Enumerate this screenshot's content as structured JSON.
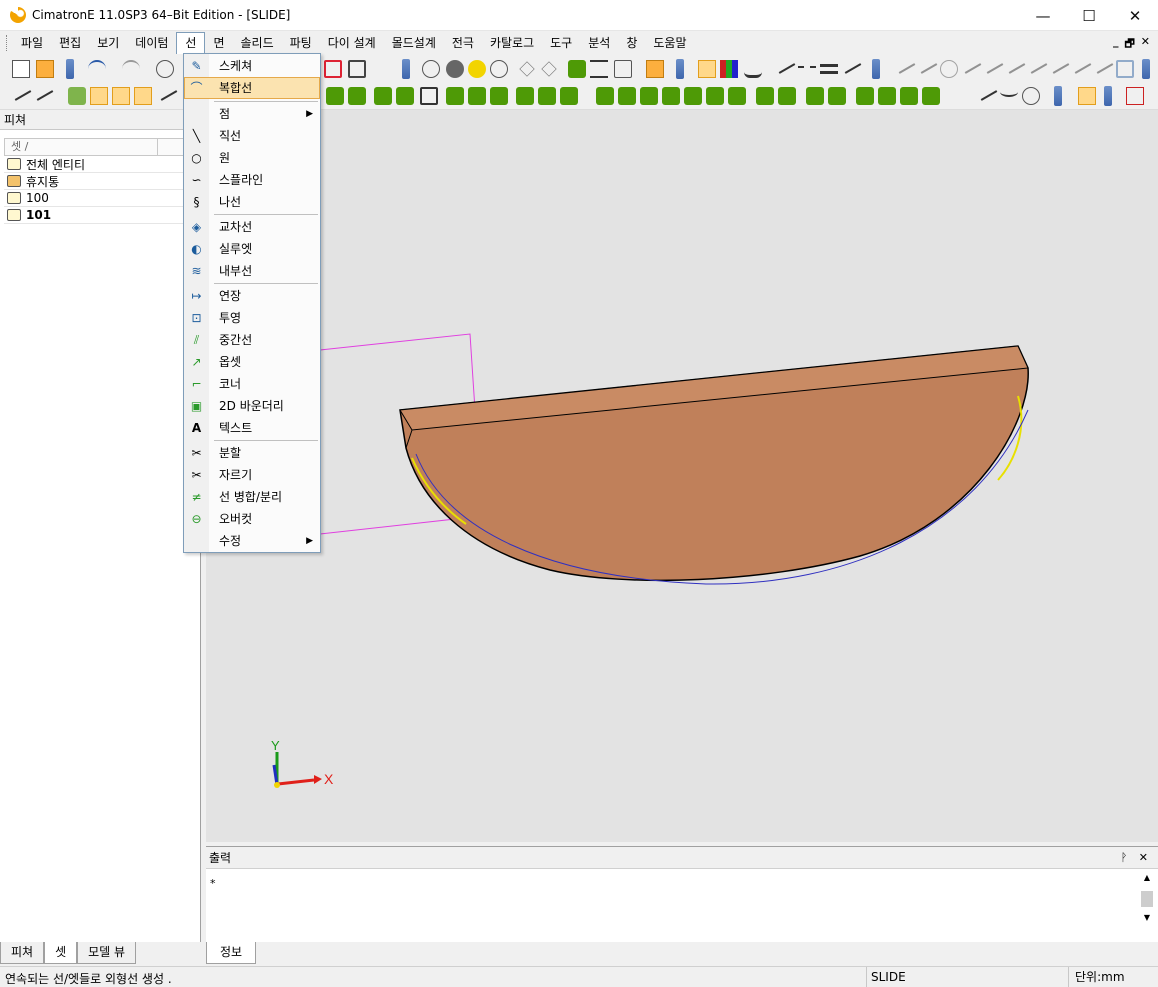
{
  "window": {
    "title": "CimatronE 11.0SP3 64–Bit Edition - [SLIDE]",
    "minimize": "—",
    "maximize": "☐",
    "close": "✕"
  },
  "menubar": {
    "items": [
      "파일",
      "편집",
      "보기",
      "데이텀",
      "선",
      "면",
      "솔리드",
      "파팅",
      "다이 설계",
      "몰드설계",
      "전극",
      "카탈로그",
      "도구",
      "분석",
      "창",
      "도움말"
    ],
    "active_index": 4,
    "mdi_min": "_",
    "mdi_restore": "🗗",
    "mdi_close": "✕"
  },
  "line_menu": {
    "items": [
      {
        "label": "스케쳐",
        "icon": "sketcher-icon"
      },
      {
        "label": "복합선",
        "icon": "composite-curve-icon",
        "highlighted": true
      },
      {
        "label": "점",
        "icon": "",
        "submenu": true
      },
      {
        "label": "직선",
        "icon": "line-icon"
      },
      {
        "label": "원",
        "icon": "circle-icon"
      },
      {
        "label": "스플라인",
        "icon": "spline-icon"
      },
      {
        "label": "나선",
        "icon": "helix-icon"
      },
      {
        "label": "교차선",
        "icon": "intersection-curve-icon"
      },
      {
        "label": "실루엣",
        "icon": "silhouette-icon"
      },
      {
        "label": "내부선",
        "icon": "internal-curve-icon"
      },
      {
        "label": "연장",
        "icon": "extend-icon"
      },
      {
        "label": "투영",
        "icon": "project-icon"
      },
      {
        "label": "중간선",
        "icon": "midline-icon"
      },
      {
        "label": "옵셋",
        "icon": "offset-icon"
      },
      {
        "label": "코너",
        "icon": "corner-icon"
      },
      {
        "label": "2D 바운더리",
        "icon": "boundary-2d-icon"
      },
      {
        "label": "텍스트",
        "icon": "text-icon"
      },
      {
        "label": "분할",
        "icon": "split-icon"
      },
      {
        "label": "자르기",
        "icon": "trim-icon"
      },
      {
        "label": "선 병합/분리",
        "icon": "merge-split-icon"
      },
      {
        "label": "오버컷",
        "icon": "overcut-icon"
      },
      {
        "label": "수정",
        "icon": "modify-icon",
        "submenu": true
      }
    ]
  },
  "left_panel": {
    "title": "피쳐",
    "pin": "ᚹ",
    "column_header": "셋 /",
    "rows": [
      {
        "label": "전체 엔티티",
        "bold": false
      },
      {
        "label": "휴지통",
        "bold": false
      },
      {
        "label": "100",
        "bold": false
      },
      {
        "label": "101",
        "bold": true
      }
    ]
  },
  "viewport": {
    "axis_x": "X",
    "axis_y": "Y",
    "colors": {
      "background": "#e3e3e3",
      "solid_face": "#c0805a",
      "solid_edge": "#000000",
      "sketch_line": "#e040e0",
      "x_axis": "#e0201a",
      "y_axis": "#1a9a1a"
    }
  },
  "output_panel": {
    "title": "출력",
    "controls": "ᚹ ✕",
    "text": "*"
  },
  "left_tabs": [
    "피쳐",
    "셋",
    "모델 뷰"
  ],
  "left_tabs_active": 1,
  "right_tab": "정보",
  "statusbar": {
    "message": "연속되는 선/엣들로 외형선 생성 .",
    "mode": "SLIDE",
    "unit": "단위:mm"
  }
}
